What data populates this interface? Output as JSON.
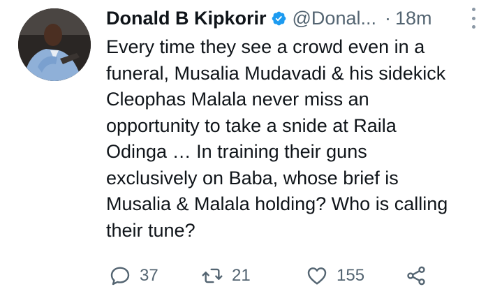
{
  "author": {
    "name": "Donald B Kipkorir",
    "handle": "@Donal...",
    "separator": "·",
    "time": "18m",
    "verified": true
  },
  "tweet": {
    "lines": [
      "Every time they see a crowd even in a",
      "funeral, Musalia Mudavadi & his sidekick",
      "Cleophas Malala never miss an",
      "opportunity to take a snide at Raila",
      "Odinga … In training their guns",
      "exclusively on Baba, whose brief is",
      "Musalia & Malala holding? Who is calling",
      "their tune?"
    ]
  },
  "actions": {
    "replies": "37",
    "retweets": "21",
    "likes": "155"
  },
  "icons": {
    "verified": "verified-badge-icon",
    "more": "more-vertical-icon",
    "reply": "reply-icon",
    "retweet": "retweet-icon",
    "like": "heart-icon",
    "share": "share-icon"
  },
  "colors": {
    "text": "#0f1419",
    "secondary": "#536471",
    "verified": "#1d9bf0"
  }
}
